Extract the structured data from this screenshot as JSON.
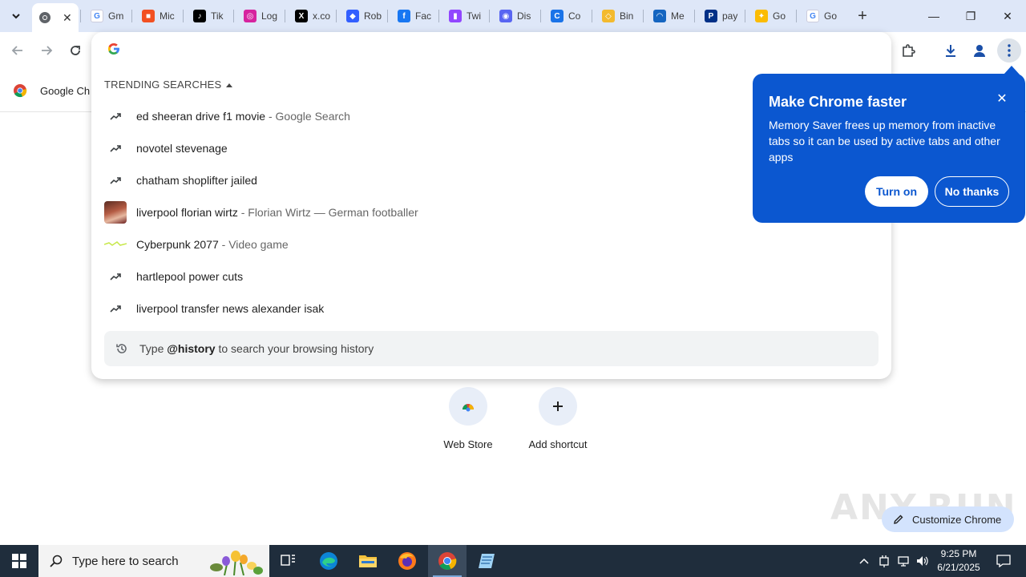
{
  "tabs": [
    {
      "name": "tab-google",
      "label": "",
      "fav_color": "#5f6368",
      "fav_glyph": "",
      "left": 0
    },
    {
      "label": "Gm",
      "fav_color": "#ffffff",
      "fav_glyph": "G"
    },
    {
      "label": "Mic",
      "fav_color": "#f25022",
      "fav_glyph": "■"
    },
    {
      "label": "Tik",
      "fav_color": "#000000",
      "fav_glyph": "♪"
    },
    {
      "label": "Log",
      "fav_color": "#d6249f",
      "fav_glyph": "◎"
    },
    {
      "label": "x.co",
      "fav_color": "#000000",
      "fav_glyph": "X"
    },
    {
      "label": "Rob",
      "fav_color": "#335fff",
      "fav_glyph": "◆"
    },
    {
      "label": "Fac",
      "fav_color": "#1877f2",
      "fav_glyph": "f"
    },
    {
      "label": "Twi",
      "fav_color": "#9146ff",
      "fav_glyph": "▮"
    },
    {
      "label": "Dis",
      "fav_color": "#5865f2",
      "fav_glyph": "◉"
    },
    {
      "label": "Co",
      "fav_color": "#1a73e8",
      "fav_glyph": "C"
    },
    {
      "label": "Bin",
      "fav_color": "#f3ba2f",
      "fav_glyph": "◇"
    },
    {
      "label": "Me",
      "fav_color": "#1565c0",
      "fav_glyph": "◠"
    },
    {
      "label": "pay",
      "fav_color": "#003087",
      "fav_glyph": "P"
    },
    {
      "label": "Go",
      "fav_color": "#fbbc04",
      "fav_glyph": "✦"
    },
    {
      "label": "Go",
      "fav_color": "#ffffff",
      "fav_glyph": "G"
    }
  ],
  "window": {
    "minimize": "—",
    "restore": "❐",
    "close": "✕",
    "newtab": "+"
  },
  "bookmarks": {
    "item_label": "Google Ch"
  },
  "omnibox": {
    "input_value": "",
    "trending_heading": "TRENDING SEARCHES",
    "suggestions": [
      {
        "main": "ed sheeran drive f1 movie",
        "sub": " - Google Search",
        "icon": "trend-icon"
      },
      {
        "main": "novotel stevenage",
        "sub": "",
        "icon": "trend-icon"
      },
      {
        "main": "chatham shoplifter jailed",
        "sub": "",
        "icon": "trend-icon"
      },
      {
        "main": "liverpool florian wirtz",
        "sub": " - Florian Wirtz — German footballer",
        "icon": "thumbnail"
      },
      {
        "main": "Cyberpunk 2077",
        "sub": " - Video game",
        "icon": "game-thumbnail"
      },
      {
        "main": "hartlepool power cuts",
        "sub": "",
        "icon": "trend-icon"
      },
      {
        "main": "liverpool transfer news alexander isak",
        "sub": "",
        "icon": "trend-icon"
      }
    ],
    "history_prefix": "Type ",
    "history_keyword": "@history",
    "history_suffix": " to search your browsing history"
  },
  "promo": {
    "title": "Make Chrome faster",
    "body": "Memory Saver frees up memory from inactive tabs so it can be used by active tabs and other apps",
    "turn_on": "Turn on",
    "no_thanks": "No thanks",
    "accent": "#0b57d0"
  },
  "shortcuts": [
    {
      "label": "Web Store"
    },
    {
      "label": "Add shortcut"
    }
  ],
  "customize_label": "Customize Chrome",
  "watermark": "ANY.RUN",
  "taskbar": {
    "search_placeholder": "Type here to search",
    "time": "9:25 PM",
    "date": "6/21/2025"
  }
}
